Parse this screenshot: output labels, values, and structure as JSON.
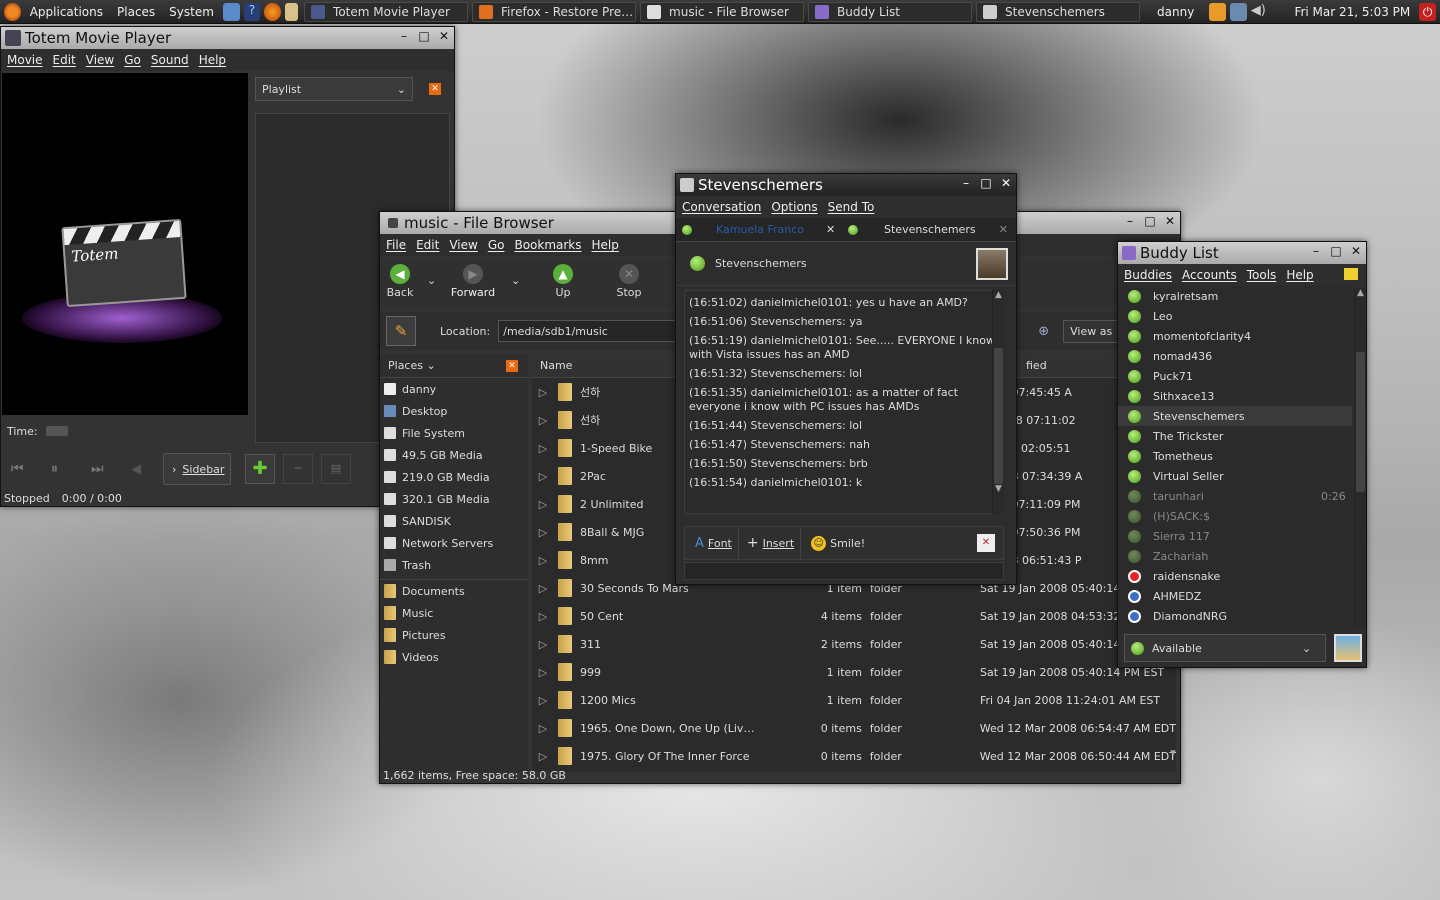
{
  "panel": {
    "menus": [
      "Applications",
      "Places",
      "System"
    ],
    "tasks": [
      {
        "label": "Totem Movie Player",
        "icon": "film-icon",
        "width": 164
      },
      {
        "label": "Firefox - Restore Pre…",
        "icon": "firefox-icon",
        "width": 164
      },
      {
        "label": "music - File Browser",
        "icon": "folder-icon",
        "width": 164
      },
      {
        "label": "Buddy List",
        "icon": "pidgin-icon",
        "width": 164
      },
      {
        "label": "Stevenschemers",
        "icon": "chat-icon",
        "width": 164
      }
    ],
    "user": "danny",
    "clock": "Fri Mar 21,  5:03 PM"
  },
  "totem": {
    "title": "Totem Movie Player",
    "menus": [
      "Movie",
      "Edit",
      "View",
      "Go",
      "Sound",
      "Help"
    ],
    "logo": "Totem",
    "playlist_label": "Playlist",
    "time_label": "Time:",
    "sidebar_label": "Sidebar",
    "status": "Stopped",
    "time": "0:00 / 0:00"
  },
  "browser": {
    "title": "music - File Browser",
    "menus": [
      "File",
      "Edit",
      "View",
      "Go",
      "Bookmarks",
      "Help"
    ],
    "toolbar": {
      "back": "Back",
      "forward": "Forward",
      "up": "Up",
      "stop": "Stop"
    },
    "location_label": "Location:",
    "location_value": "/media/sdb1/music",
    "view_as": "View as",
    "places_label": "Places",
    "places": [
      "danny",
      "Desktop",
      "File System",
      "49.5 GB Media",
      "219.0 GB Media",
      "320.1 GB Media",
      "SANDISK",
      "Network Servers",
      "Trash"
    ],
    "bookmarks": [
      "Documents",
      "Music",
      "Pictures",
      "Videos"
    ],
    "col_name": "Name",
    "col_modified": "fied",
    "files": [
      {
        "name": "선하",
        "size": "",
        "type": "",
        "date": "2008 07:45:45 A"
      },
      {
        "name": "선하",
        "size": "",
        "type": "",
        "date": "ar 2008 07:11:02"
      },
      {
        "name": "1-Speed Bike",
        "size": "",
        "type": "",
        "date": "c 2007 02:05:51"
      },
      {
        "name": "2Pac",
        "size": "",
        "type": "",
        "date": "n 2008 07:34:39 A"
      },
      {
        "name": "2 Unlimited",
        "size": "",
        "type": "",
        "date": "2008 07:11:09 PM"
      },
      {
        "name": "8Ball & MJG",
        "size": "",
        "type": "",
        "date": "2008 07:50:36 PM"
      },
      {
        "name": "8mm",
        "size": "",
        "type": "",
        "date": "n 2008 06:51:43 P"
      },
      {
        "name": "30 Seconds To Mars",
        "size": "1 item",
        "type": "folder",
        "date": "Sat 19 Jan 2008 05:40:14 PM"
      },
      {
        "name": "50 Cent",
        "size": "4 items",
        "type": "folder",
        "date": "Sat 19 Jan 2008 04:53:32 PM"
      },
      {
        "name": "311",
        "size": "2 items",
        "type": "folder",
        "date": "Sat 19 Jan 2008 05:40:14 PM"
      },
      {
        "name": "999",
        "size": "1 item",
        "type": "folder",
        "date": "Sat 19 Jan 2008 05:40:14 PM EST"
      },
      {
        "name": "1200 Mics",
        "size": "1 item",
        "type": "folder",
        "date": "Fri 04 Jan 2008 11:24:01 AM EST"
      },
      {
        "name": "1965. One Down, One Up (Liv…",
        "size": "0 items",
        "type": "folder",
        "date": "Wed 12 Mar 2008 06:54:47 AM EDT"
      },
      {
        "name": "1975. Glory Of The Inner Force",
        "size": "0 items",
        "type": "folder",
        "date": "Wed 12 Mar 2008 06:50:44 AM EDT"
      }
    ],
    "status": "1,662 items, Free space: 58.0 GB"
  },
  "chat": {
    "title": "Stevenschemers",
    "menus": [
      "Conversation",
      "Options",
      "Send To"
    ],
    "tabs": [
      "Kamuela Franco",
      "Stevenschemers"
    ],
    "buddy": "Stevenschemers",
    "messages": [
      "(16:51:02) danielmichel0101: yes u have an AMD?",
      "(16:51:06) Stevenschemers: ya",
      "(16:51:19) danielmichel0101: See..... EVERYONE I know with Vista issues has an AMD",
      "(16:51:32) Stevenschemers: lol",
      "(16:51:35) danielmichel0101: as a matter of fact everyone i know with PC issues has AMDs",
      "(16:51:44) Stevenschemers: lol",
      "(16:51:47) Stevenschemers: nah",
      "(16:51:50) Stevenschemers: brb",
      "(16:51:54) danielmichel0101: k"
    ],
    "font": "Font",
    "insert": "Insert",
    "smile": "Smile!"
  },
  "buddies": {
    "title": "Buddy List",
    "menus": [
      "Buddies",
      "Accounts",
      "Tools",
      "Help"
    ],
    "list": [
      {
        "name": "kyralretsam",
        "status": "online",
        "idle": ""
      },
      {
        "name": "Leo",
        "status": "online",
        "idle": ""
      },
      {
        "name": "momentofclarity4",
        "status": "online",
        "idle": ""
      },
      {
        "name": "nomad436",
        "status": "online",
        "idle": ""
      },
      {
        "name": "Puck71",
        "status": "online",
        "idle": ""
      },
      {
        "name": "Sithxace13",
        "status": "online",
        "idle": ""
      },
      {
        "name": "Stevenschemers",
        "status": "online",
        "idle": ""
      },
      {
        "name": "The Trickster",
        "status": "online",
        "idle": ""
      },
      {
        "name": "Tometheus",
        "status": "online",
        "idle": ""
      },
      {
        "name": "Virtual Seller",
        "status": "online",
        "idle": ""
      },
      {
        "name": "tarunhari",
        "status": "idle",
        "idle": "0:26"
      },
      {
        "name": "(H)SACK:$",
        "status": "idle",
        "idle": ""
      },
      {
        "name": "Sierra 117",
        "status": "idle",
        "idle": ""
      },
      {
        "name": "Zachariah",
        "status": "idle",
        "idle": ""
      },
      {
        "name": "raidensnake",
        "status": "busy",
        "idle": ""
      },
      {
        "name": "AHMEDZ",
        "status": "away",
        "idle": ""
      },
      {
        "name": "DiamondNRG",
        "status": "away",
        "idle": ""
      }
    ],
    "status": "Available"
  }
}
